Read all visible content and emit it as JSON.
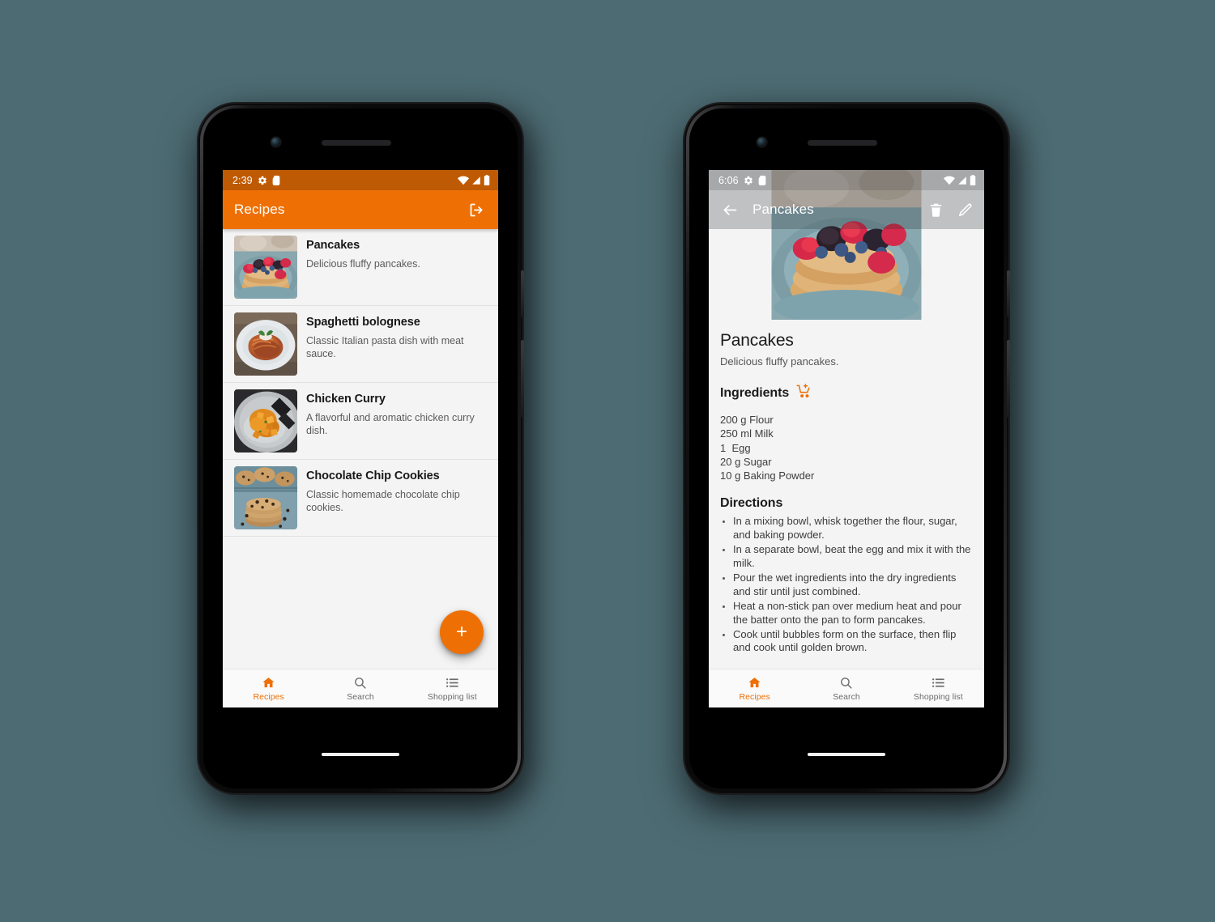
{
  "background_color": "#4d6b73",
  "theme": {
    "accent": "#ee7004",
    "status_bar_orange": "#bf5a04",
    "screen_bg": "#f4f4f4",
    "nav_bg": "#fafafa",
    "title_text": "#181818",
    "body_text": "#5b5b5b"
  },
  "phone_list": {
    "status_bar": {
      "time": "2:39",
      "left_icons": [
        "settings-gear-icon",
        "sd-card-icon"
      ],
      "right_icons": [
        "wifi-icon",
        "cell-signal-icon",
        "battery-icon"
      ]
    },
    "app_bar": {
      "title": "Recipes",
      "action_icon": "logout-icon"
    },
    "recipes": [
      {
        "title": "Pancakes",
        "description": "Delicious fluffy pancakes.",
        "thumbnail": "pancakes-berries-photo"
      },
      {
        "title": "Spaghetti bolognese",
        "description": "Classic Italian pasta dish with meat sauce.",
        "thumbnail": "spaghetti-bolognese-photo"
      },
      {
        "title": "Chicken Curry",
        "description": "A flavorful and aromatic chicken curry dish.",
        "thumbnail": "chicken-curry-photo"
      },
      {
        "title": "Chocolate Chip Cookies",
        "description": "Classic homemade chocolate chip cookies.",
        "thumbnail": "chocolate-chip-cookies-photo"
      }
    ],
    "fab": {
      "label": "+",
      "icon": "plus-icon"
    },
    "bottom_nav": {
      "active": "Recipes",
      "items": [
        {
          "label": "Recipes",
          "icon": "home-icon"
        },
        {
          "label": "Search",
          "icon": "search-icon"
        },
        {
          "label": "Shopping list",
          "icon": "list-icon"
        }
      ]
    }
  },
  "phone_detail": {
    "status_bar": {
      "time": "6:06",
      "left_icons": [
        "settings-gear-icon",
        "sd-card-icon"
      ],
      "right_icons": [
        "wifi-icon",
        "cell-signal-icon",
        "battery-icon"
      ]
    },
    "app_bar": {
      "back_icon": "back-arrow-icon",
      "title": "Pancakes",
      "delete_icon": "trash-icon",
      "edit_icon": "pencil-icon"
    },
    "hero_image": "pancakes-berries-photo",
    "recipe": {
      "name": "Pancakes",
      "description": "Delicious fluffy pancakes.",
      "ingredients_heading": "Ingredients",
      "add_to_cart_icon": "add-to-cart-icon",
      "ingredients": [
        "200 g Flour",
        "250 ml Milk",
        "1  Egg",
        "20 g Sugar",
        "10 g Baking Powder"
      ],
      "directions_heading": "Directions",
      "directions": [
        "In a mixing bowl, whisk together the flour, sugar, and baking powder.",
        "In a separate bowl, beat the egg and mix it with the milk.",
        "Pour the wet ingredients into the dry ingredients and stir until just combined.",
        "Heat a non-stick pan over medium heat and pour the batter onto the pan to form pancakes.",
        "Cook until bubbles form on the surface, then flip and cook until golden brown."
      ]
    },
    "bottom_nav": {
      "active": "Recipes",
      "items": [
        {
          "label": "Recipes",
          "icon": "home-icon"
        },
        {
          "label": "Search",
          "icon": "search-icon"
        },
        {
          "label": "Shopping list",
          "icon": "list-icon"
        }
      ]
    }
  }
}
